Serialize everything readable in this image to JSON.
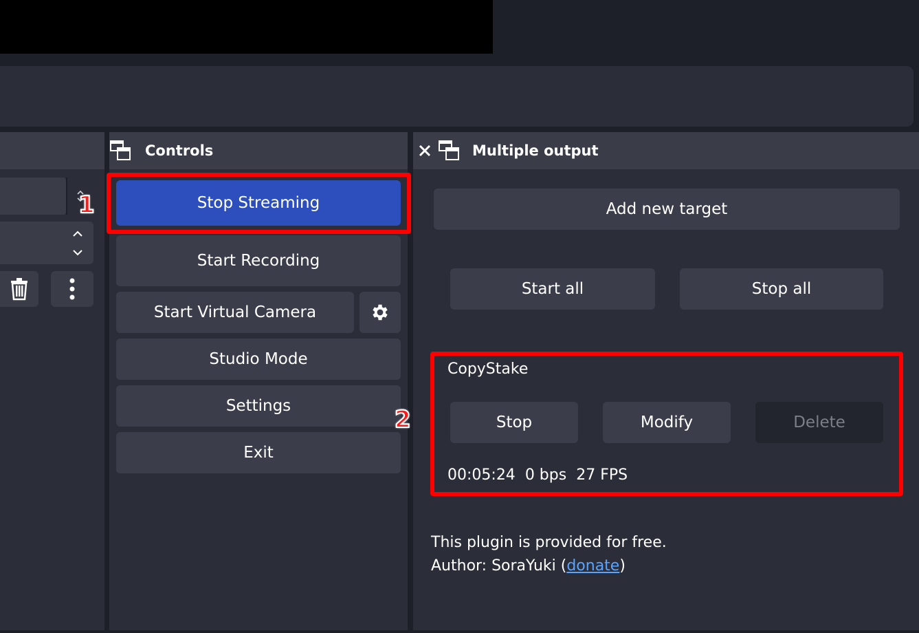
{
  "controls_dock": {
    "title": "Controls",
    "buttons": {
      "stop_streaming": "Stop Streaming",
      "start_recording": "Start Recording",
      "start_virtual_camera": "Start Virtual Camera",
      "studio_mode": "Studio Mode",
      "settings": "Settings",
      "exit": "Exit"
    },
    "icons": {
      "virtual_camera_settings": "gear-icon",
      "dock": "undock-icon"
    }
  },
  "multiple_output_dock": {
    "title": "Multiple output",
    "add_target_label": "Add new target",
    "start_all_label": "Start all",
    "stop_all_label": "Stop all",
    "target": {
      "name": "CopyStake",
      "stop_label": "Stop",
      "modify_label": "Modify",
      "delete_label": "Delete",
      "status": {
        "elapsed": "00:05:24",
        "bitrate": "0 bps",
        "fps": "27 FPS"
      }
    },
    "footer": {
      "line1": "This plugin is provided for free.",
      "author_prefix": "Author: SoraYuki (",
      "donate_link": "donate",
      "author_suffix": ")"
    }
  },
  "annotations": {
    "marker1": "1",
    "marker2": "2",
    "highlight_color": "#ff0000"
  },
  "colors": {
    "primary_button": "#2c4fbd",
    "button": "#3b3e4a",
    "dock_bg": "#2b2e38",
    "link": "#5aa3ff"
  }
}
